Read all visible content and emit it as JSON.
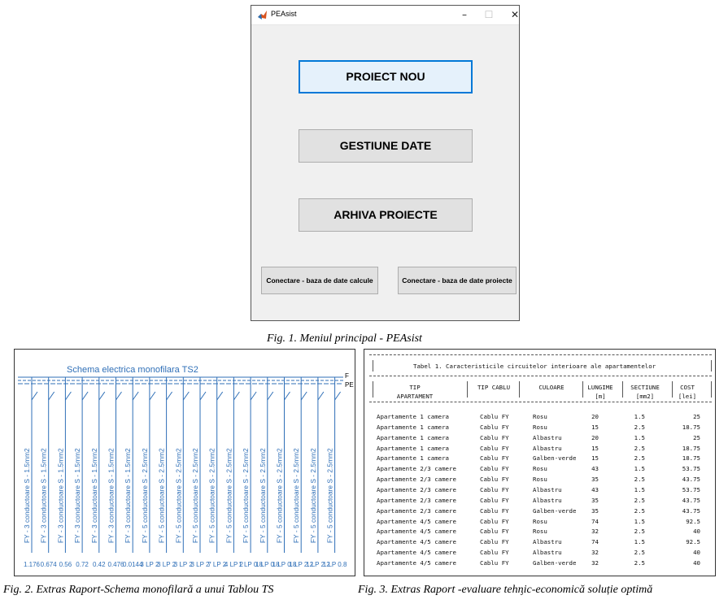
{
  "window": {
    "title": "PEAsist",
    "buttons": {
      "new_project": "PROIECT NOU",
      "data_management": "GESTIUNE DATE",
      "project_archive": "ARHIVA PROIECTE",
      "connect_calc_db": "Conectare - baza de date  calcule",
      "connect_project_db": "Conectare - baza de date proiecte"
    }
  },
  "captions": {
    "fig1": "Fig. 1. Meniul principal - PEAsist",
    "fig2": "Fig.  2. Extras Raport-Schema monofilară a unui Tablou TS",
    "fig3": "Fig. 3. Extras Raport -evaluare tehᶇic-economică soluție optimă"
  },
  "schematic": {
    "title": "Schema electrica monofilara TS2",
    "bus_labels": [
      "F",
      "PE"
    ],
    "circuits": [
      {
        "label": "FY - 3 conductoare  S - 1.5mm2",
        "value": "1.176"
      },
      {
        "label": "FY - 3 conductoare  S - 1.5mm2",
        "value": "0.674"
      },
      {
        "label": "FY - 3 conductoare  S - 1.5mm2",
        "value": "0.56"
      },
      {
        "label": "FY - 3 conductoare  S - 1.5mm2",
        "value": "0.72"
      },
      {
        "label": "FY - 3 conductoare  S - 1.5mm2",
        "value": "0.42"
      },
      {
        "label": "FY - 3 conductoare  S - 1.5mm2",
        "value": "0.476"
      },
      {
        "label": "FY - 3 conductoare  S - 1.5mm2",
        "value": "0.0144"
      },
      {
        "label": "FY - 5 conductoare  S - 2.5mm2",
        "value": "3 LP 2"
      },
      {
        "label": "FY - 5 conductoare  S - 2.5mm2",
        "value": "3 LP 2"
      },
      {
        "label": "FY - 5 conductoare  S - 2.5mm2",
        "value": "3 LP 2"
      },
      {
        "label": "FY - 5 conductoare  S - 2.5mm2",
        "value": "3 LP 2"
      },
      {
        "label": "FY - 5 conductoare  S - 2.5mm2",
        "value": "7 LP 2"
      },
      {
        "label": "FY - 5 conductoare  S - 2.5mm2",
        "value": "4 LP 2"
      },
      {
        "label": "FY - 5 conductoare  S - 2.5mm2",
        "value": "1 LP 0.8"
      },
      {
        "label": "FY - 5 conductoare  S - 2.5mm2",
        "value": "1 LP 0.8"
      },
      {
        "label": "FY - 5 conductoare  S - 2.5mm2",
        "value": "1 LP 0.8"
      },
      {
        "label": "FY - 5 conductoare  S - 2.5mm2",
        "value": "1 LP 2.2"
      },
      {
        "label": "FY - 5 conductoare  S - 2.5mm2",
        "value": "1 LP 2.2"
      },
      {
        "label": "FY - 5 conductoare  S - 2.5mm2",
        "value": "1 LP 0.8"
      }
    ]
  },
  "report_table": {
    "title": "Tabel 1. Caracteristicile circuitelor interioare ale apartamentelor",
    "headers": [
      [
        "TIP",
        "APARTAMENT"
      ],
      [
        "TIP CABLU"
      ],
      [
        "CULOARE"
      ],
      [
        "LUNGIME",
        "[m]"
      ],
      [
        "SECTIUNE",
        "[mm2]"
      ],
      [
        "COST",
        "[lei]"
      ]
    ],
    "rows": [
      [
        "Apartamente 1 camera",
        "Cablu FY",
        "Rosu",
        "20",
        "1.5",
        "25"
      ],
      [
        "Apartamente 1 camera",
        "Cablu FY",
        "Rosu",
        "15",
        "2.5",
        "18.75"
      ],
      [
        "Apartamente 1 camera",
        "Cablu FY",
        "Albastru",
        "20",
        "1.5",
        "25"
      ],
      [
        "Apartamente 1 camera",
        "Cablu FY",
        "Albastru",
        "15",
        "2.5",
        "18.75"
      ],
      [
        "Apartamente 1 camera",
        "Cablu FY",
        "Galben-verde",
        "15",
        "2.5",
        "18.75"
      ],
      [
        "Apartamente 2/3 camere",
        "Cablu FY",
        "Rosu",
        "43",
        "1.5",
        "53.75"
      ],
      [
        "Apartamente 2/3 camere",
        "Cablu FY",
        "Rosu",
        "35",
        "2.5",
        "43.75"
      ],
      [
        "Apartamente 2/3 camere",
        "Cablu FY",
        "Albastru",
        "43",
        "1.5",
        "53.75"
      ],
      [
        "Apartamente 2/3 camere",
        "Cablu FY",
        "Albastru",
        "35",
        "2.5",
        "43.75"
      ],
      [
        "Apartamente 2/3 camere",
        "Cablu FY",
        "Galben-verde",
        "35",
        "2.5",
        "43.75"
      ],
      [
        "Apartamente 4/5 camere",
        "Cablu FY",
        "Rosu",
        "74",
        "1.5",
        "92.5"
      ],
      [
        "Apartamente 4/5 camere",
        "Cablu FY",
        "Rosu",
        "32",
        "2.5",
        "40"
      ],
      [
        "Apartamente 4/5 camere",
        "Cablu FY",
        "Albastru",
        "74",
        "1.5",
        "92.5"
      ],
      [
        "Apartamente 4/5 camere",
        "Cablu FY",
        "Albastru",
        "32",
        "2.5",
        "40"
      ],
      [
        "Apartamente 4/5 camere",
        "Cablu FY",
        "Galben-verde",
        "32",
        "2.5",
        "40"
      ]
    ]
  },
  "colors": {
    "schematic_blue": "#2f6fb7",
    "focus_blue": "#0078d7"
  }
}
